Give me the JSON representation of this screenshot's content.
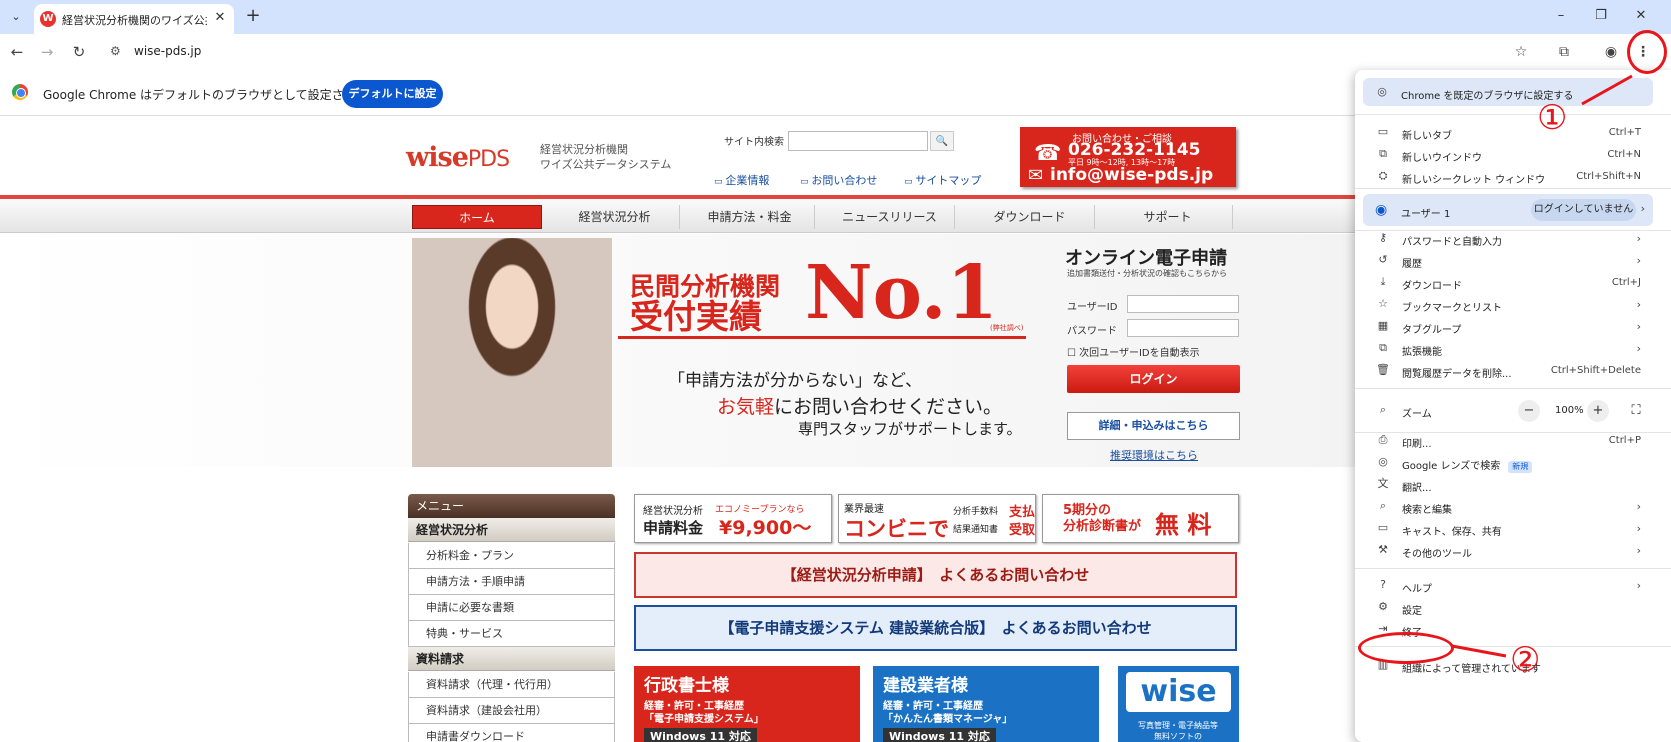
{
  "browser": {
    "tab_title": "経営状況分析機関のワイズ公共デ",
    "tab_favicon": "W",
    "url": "wise-pds.jp",
    "infobar_text": "Google Chrome はデフォルトのブラウザとして設定されていません",
    "infobar_button": "デフォルトに設定"
  },
  "site": {
    "logo_wise": "wise",
    "logo_pds": "PDS",
    "tagline_1": "経営状況分析機関",
    "tagline_2": "ワイズ公共データシステム",
    "search_label": "サイト内検索",
    "links": [
      "企業情報",
      "お問い合わせ",
      "サイトマップ"
    ],
    "contact": {
      "line1": "お問い合わせ・ご相談",
      "phone": "026-232-1145",
      "hours": "平日 9時～12時, 13時～17時",
      "email": "info@wise-pds.jp"
    },
    "nav": [
      "ホーム",
      "経営状況分析",
      "申請方法・料金",
      "ニュースリリース",
      "ダウンロード",
      "サポート"
    ],
    "hero": {
      "h1a": "民間分析機関",
      "h1b": "受付実績",
      "no1": "No.1",
      "note": "(弊社調べ)",
      "t1": "「申請方法が分からない」など、",
      "t2a": "お気軽",
      "t2b": "にお問い合わせください。",
      "t3": "専門スタッフがサポートします。"
    },
    "login": {
      "title": "オンライン電子申請",
      "sub": "追加書類送付・分析状況の確認もこちらから",
      "user_label": "ユーザーID",
      "pass_label": "パスワード",
      "remember": "次回ユーザーIDを自動表示",
      "button": "ログイン",
      "detail": "詳細・申込みはこちら",
      "env": "推奨環境はこちら"
    },
    "menu": {
      "head": "メニュー",
      "sec1": "経営状況分析",
      "items1": [
        "分析料金・プラン",
        "申請方法・手順申請",
        "申請に必要な書類",
        "特典・サービス"
      ],
      "sec2": "資料請求",
      "items2": [
        "資料請求（代理・代行用）",
        "資料請求（建設会社用）",
        "申請書ダウンロード"
      ]
    },
    "banners": {
      "b1a": "経営状況分析",
      "b1b": "申請料金",
      "b1c": "エコノミープランなら",
      "b1d": "¥9,900〜",
      "b2a": "業界最速",
      "b2b": "コンビニで",
      "b2c": "分析手数料",
      "b2d": "支払",
      "b2e": "結果通知書",
      "b2f": "受取",
      "b3a1": "5期分の",
      "b3a2": "分析診断書が",
      "b3b": "無 料",
      "faq1": "【経営状況分析申請】　よくあるお問い合わせ",
      "faq2": "【電子申請支援システム 建設業統合版】　よくあるお問い合わせ",
      "p1_title": "行政書士様",
      "p1_s1": "経審・許可・工事経歴",
      "p1_s2": "「電子申請支援システム」",
      "p1_win": "Windows 11 対応",
      "p2_title": "建設業者様",
      "p2_s1": "経審・許可・工事経歴",
      "p2_s2": "「かんたん書類マネージャ」",
      "p2_win": "Windows 11 対応",
      "wise": "wise",
      "wise_sub1": "写真管理・電子納品等",
      "wise_sub2": "無料ソフトの"
    }
  },
  "chrome_menu": {
    "set_default": "Chrome を既定のブラウザに設定する",
    "new_tab": "新しいタブ",
    "new_tab_sc": "Ctrl+T",
    "new_window": "新しいウインドウ",
    "new_window_sc": "Ctrl+N",
    "incognito": "新しいシークレット ウィンドウ",
    "incognito_sc": "Ctrl+Shift+N",
    "user": "ユーザー 1",
    "user_status": "ログインしていません",
    "passwords": "パスワードと自動入力",
    "history": "履歴",
    "downloads": "ダウンロード",
    "downloads_sc": "Ctrl+J",
    "bookmarks": "ブックマークとリスト",
    "tab_groups": "タブグループ",
    "extensions": "拡張機能",
    "clear_data": "閲覧履歴データを削除...",
    "clear_data_sc": "Ctrl+Shift+Delete",
    "zoom": "ズーム",
    "zoom_value": "100%",
    "print": "印刷...",
    "print_sc": "Ctrl+P",
    "lens": "Google レンズで検索",
    "lens_badge": "新規",
    "translate": "翻訳...",
    "find_edit": "検索と編集",
    "cast": "キャスト、保存、共有",
    "more_tools": "その他のツール",
    "help": "ヘルプ",
    "settings": "設定",
    "exit": "終了",
    "managed": "組織によって管理されています"
  },
  "annotations": {
    "step1": "①",
    "step2": "②",
    "color": "#e8151b"
  }
}
